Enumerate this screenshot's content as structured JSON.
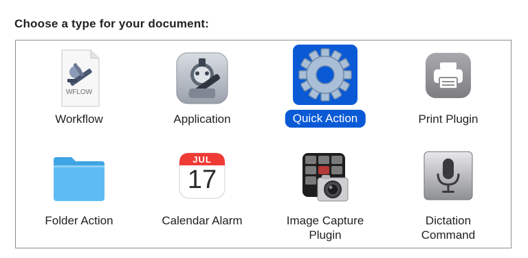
{
  "heading": "Choose a type for your document:",
  "selected_type": "Quick Action",
  "types": [
    {
      "label": "Workflow",
      "icon": "workflow-document-icon",
      "badge": "WFLOW"
    },
    {
      "label": "Application",
      "icon": "automator-robot-icon"
    },
    {
      "label": "Quick Action",
      "icon": "gear-icon"
    },
    {
      "label": "Print Plugin",
      "icon": "printer-icon"
    },
    {
      "label": "Folder Action",
      "icon": "folder-icon"
    },
    {
      "label": "Calendar Alarm",
      "icon": "calendar-icon",
      "month": "JUL",
      "day": "17"
    },
    {
      "label": "Image Capture Plugin",
      "icon": "image-capture-icon"
    },
    {
      "label": "Dictation Command",
      "icon": "microphone-icon"
    }
  ],
  "colors": {
    "selection": "#0a5ad6",
    "folder": "#4fb4ee",
    "calendar_red": "#ef3b35"
  }
}
